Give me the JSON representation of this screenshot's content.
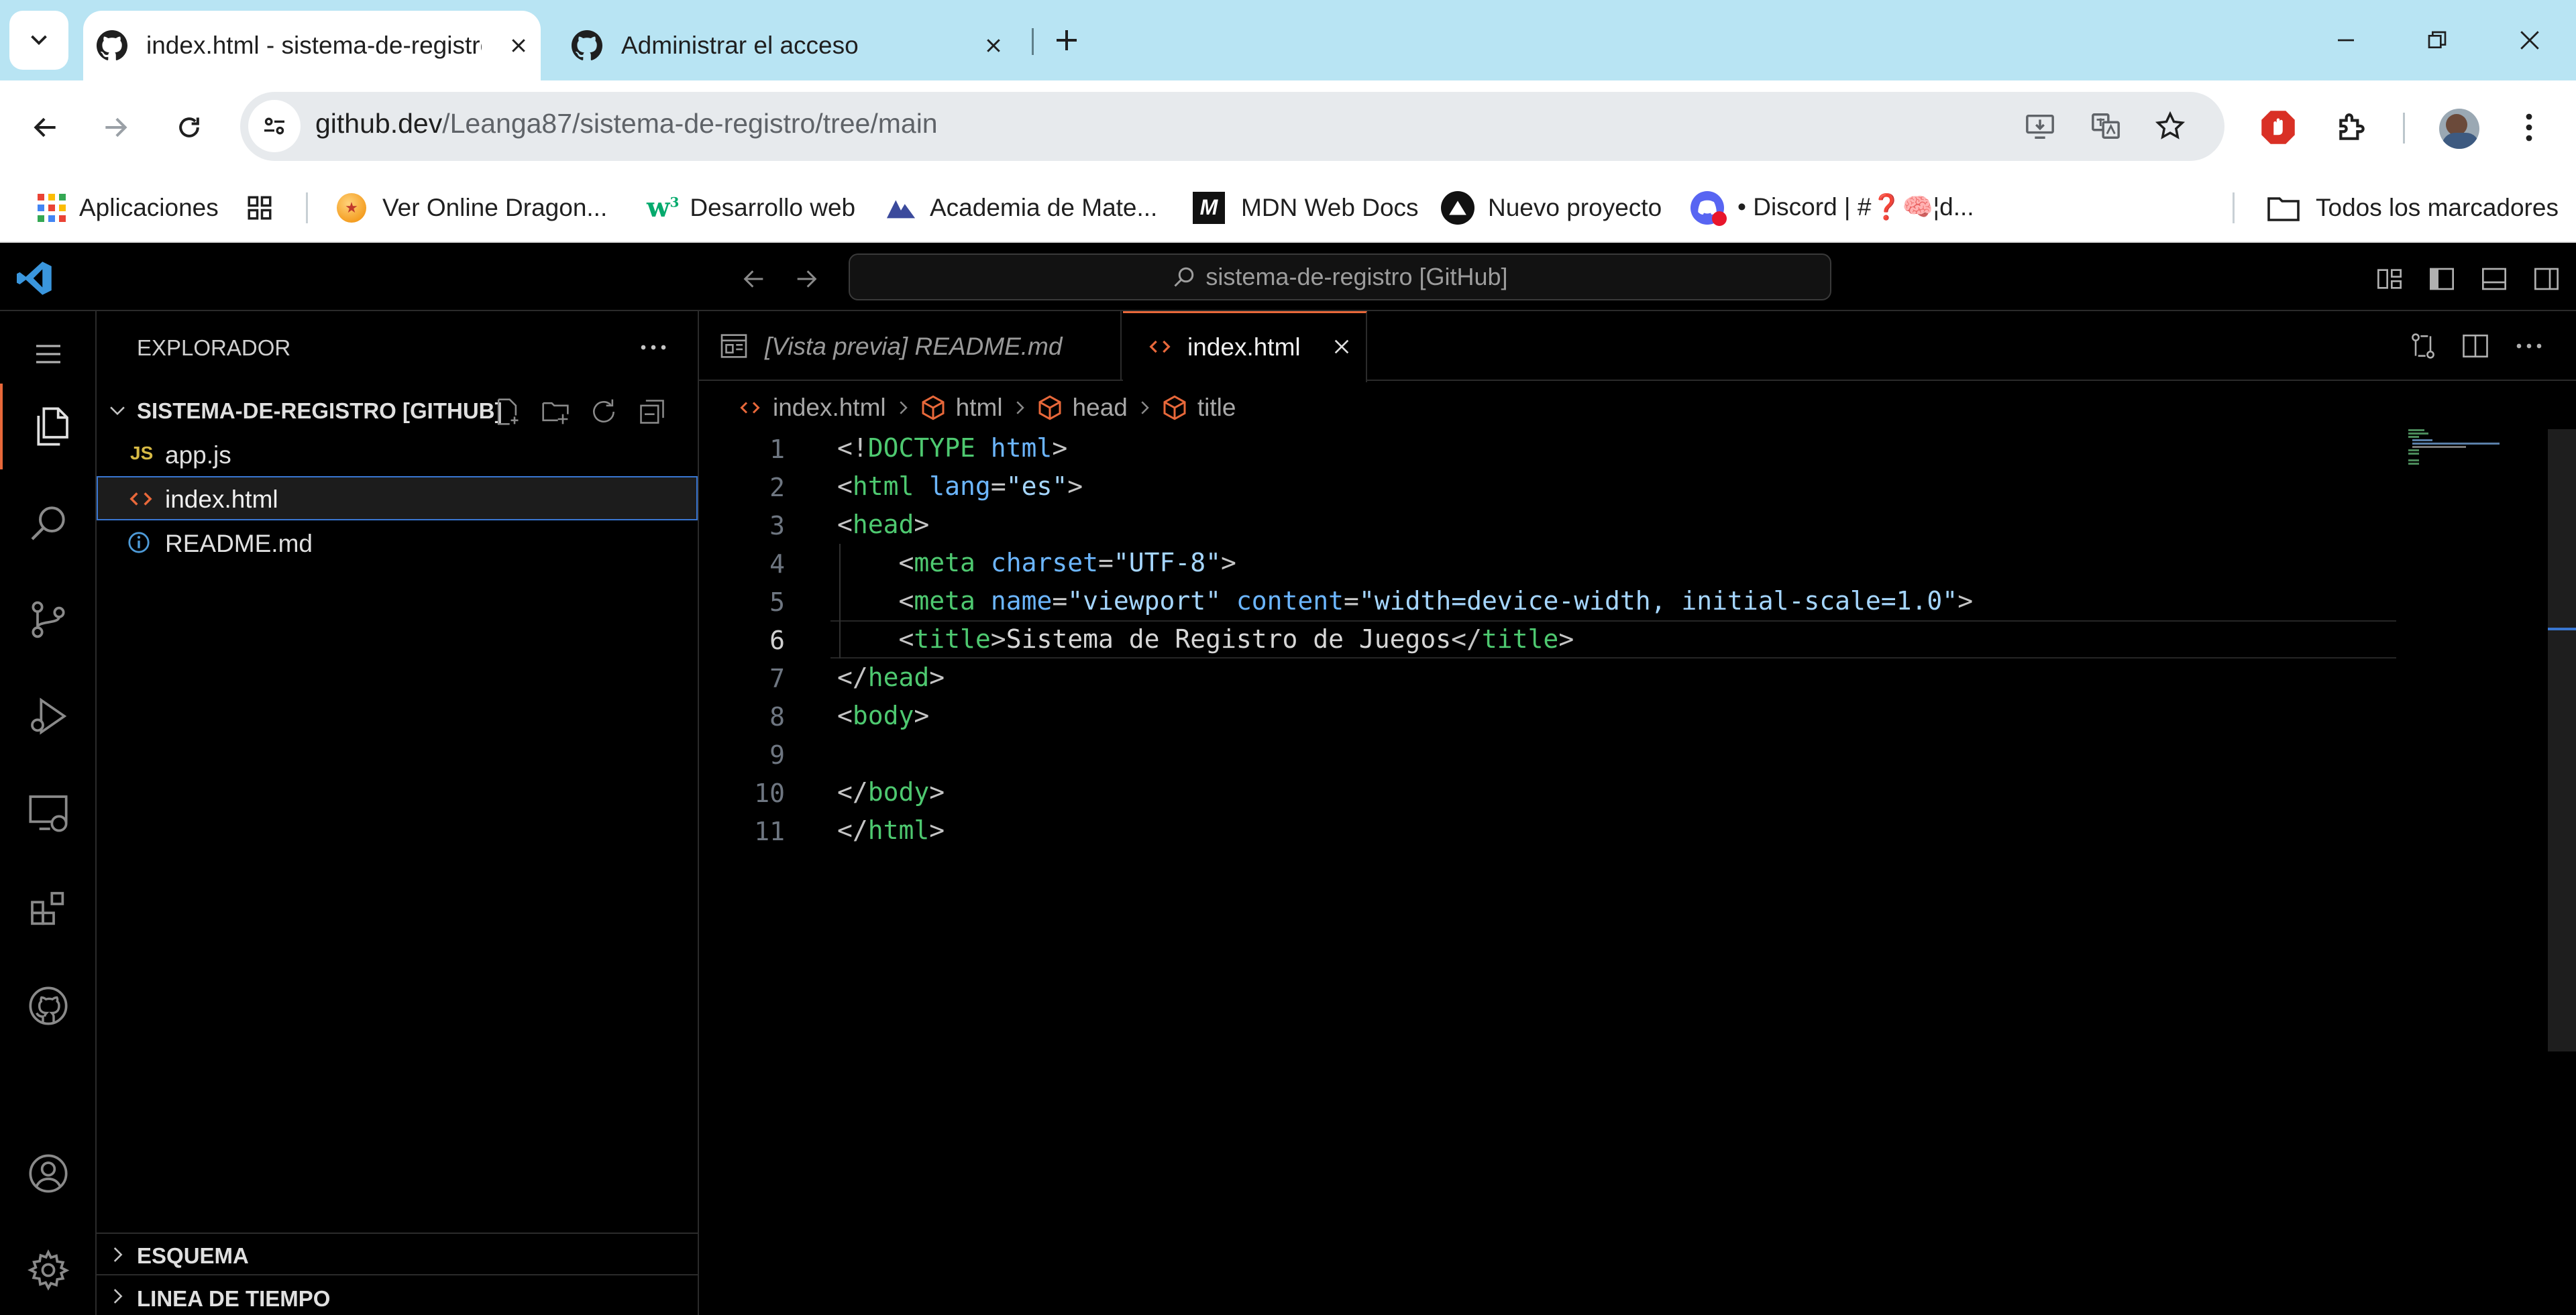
{
  "browser": {
    "tabs": [
      {
        "title": "index.html - sistema-de-registro",
        "active": true,
        "icon": "github-icon"
      },
      {
        "title": "Administrar el acceso",
        "active": false,
        "icon": "github-icon"
      }
    ],
    "url_host": "github.dev",
    "url_path": "/Leanga87/sistema-de-registro/tree/main",
    "bookmarks": [
      {
        "label": "Aplicaciones",
        "icon": "apps-grid-icon"
      },
      {
        "label": "Ver Online Dragon...",
        "icon": "dragon-ball-icon"
      },
      {
        "label": "Desarrollo web",
        "icon": "w3schools-icon"
      },
      {
        "label": "Academia de Mate...",
        "icon": "academia-icon"
      },
      {
        "label": "MDN Web Docs",
        "icon": "mdn-icon"
      },
      {
        "label": "Nuevo proyecto",
        "icon": "vercel-icon"
      },
      {
        "label": "• Discord | #❓🧠¦d...",
        "icon": "discord-icon"
      }
    ],
    "all_bookmarks": "Todos los marcadores"
  },
  "vscode": {
    "command_center": "sistema-de-registro [GitHub]",
    "explorer": {
      "title": "EXPLORADOR",
      "root": "SISTEMA-DE-REGISTRO [GITHUB]",
      "files": [
        {
          "name": "app.js",
          "type": "js",
          "badge": "JS"
        },
        {
          "name": "index.html",
          "type": "html",
          "selected": true
        },
        {
          "name": "README.md",
          "type": "md"
        }
      ],
      "outline": "ESQUEMA",
      "timeline": "LINEA DE TIEMPO"
    },
    "editor_tabs": [
      {
        "label": "[Vista previa] README.md",
        "active": false
      },
      {
        "label": "index.html",
        "active": true
      }
    ],
    "breadcrumb": [
      "index.html",
      "html",
      "head",
      "title"
    ],
    "code_lines": [
      "1",
      "2",
      "3",
      "4",
      "5",
      "6",
      "7",
      "8",
      "9",
      "10",
      "11"
    ],
    "code": {
      "l1a": "<!",
      "l1b": "DOCTYPE",
      "l1c": " html",
      "l1d": ">",
      "lang_attr": "lang",
      "lang_val": "\"es\"",
      "charset_attr": "charset",
      "charset_val": "\"UTF-8\"",
      "name_attr": "name",
      "name_val": "\"viewport\"",
      "content_attr": "content",
      "content_val": "\"width=device-width, initial-scale=1.0\"",
      "title_text": "Sistema de Registro de Juegos",
      "html": "html",
      "head": "head",
      "meta": "meta",
      "title": "title",
      "body": "body"
    },
    "active_line": 6
  }
}
